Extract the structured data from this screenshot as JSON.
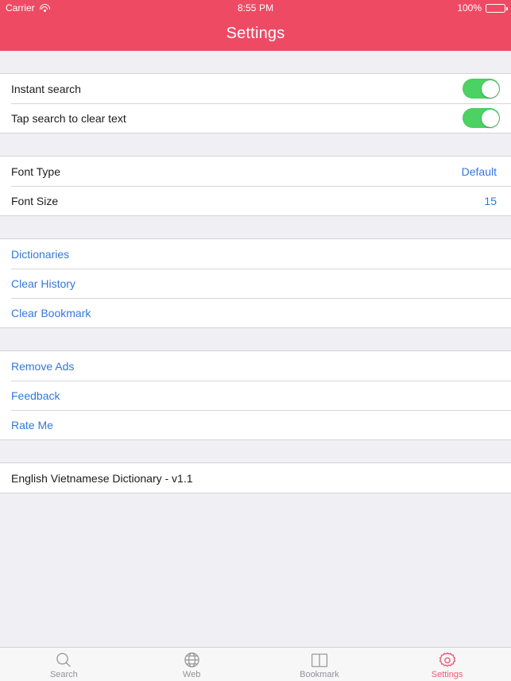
{
  "status_bar": {
    "carrier": "Carrier",
    "wifi_icon": "wifi-icon",
    "time": "8:55 PM",
    "battery_percent": "100%",
    "battery_icon": "battery-full-icon"
  },
  "nav_bar": {
    "title": "Settings",
    "background_color": "#EE4A64"
  },
  "theme": {
    "accent": "#EE4A64",
    "link_blue": "#3478D8",
    "switch_green": "#4CD263",
    "page_background": "#EFEFF4",
    "tab_active": "#EE5B72",
    "tab_inactive": "#939397"
  },
  "sections": [
    {
      "id": "search-behavior",
      "rows": [
        {
          "label": "Instant search",
          "control": "switch",
          "value": "on"
        },
        {
          "label": "Tap search to clear text",
          "control": "switch",
          "value": "on"
        }
      ]
    },
    {
      "id": "font",
      "rows": [
        {
          "label": "Font Type",
          "control": "value",
          "value": "Default"
        },
        {
          "label": "Font Size",
          "control": "value",
          "value": "15"
        }
      ]
    },
    {
      "id": "data",
      "rows": [
        {
          "label": "Dictionaries",
          "control": "link"
        },
        {
          "label": "Clear History",
          "control": "link"
        },
        {
          "label": "Clear Bookmark",
          "control": "link"
        }
      ]
    },
    {
      "id": "support",
      "rows": [
        {
          "label": "Remove Ads",
          "control": "link"
        },
        {
          "label": "Feedback",
          "control": "link"
        },
        {
          "label": "Rate Me",
          "control": "link"
        }
      ]
    },
    {
      "id": "about",
      "rows": [
        {
          "label": "English Vietnamese Dictionary - v1.1",
          "control": "none"
        }
      ]
    }
  ],
  "tab_bar": {
    "items": [
      {
        "label": "Search",
        "icon": "magnifier-icon",
        "active": false
      },
      {
        "label": "Web",
        "icon": "globe-icon",
        "active": false
      },
      {
        "label": "Bookmark",
        "icon": "open-book-icon",
        "active": false
      },
      {
        "label": "Settings",
        "icon": "gear-icon",
        "active": true
      }
    ]
  }
}
